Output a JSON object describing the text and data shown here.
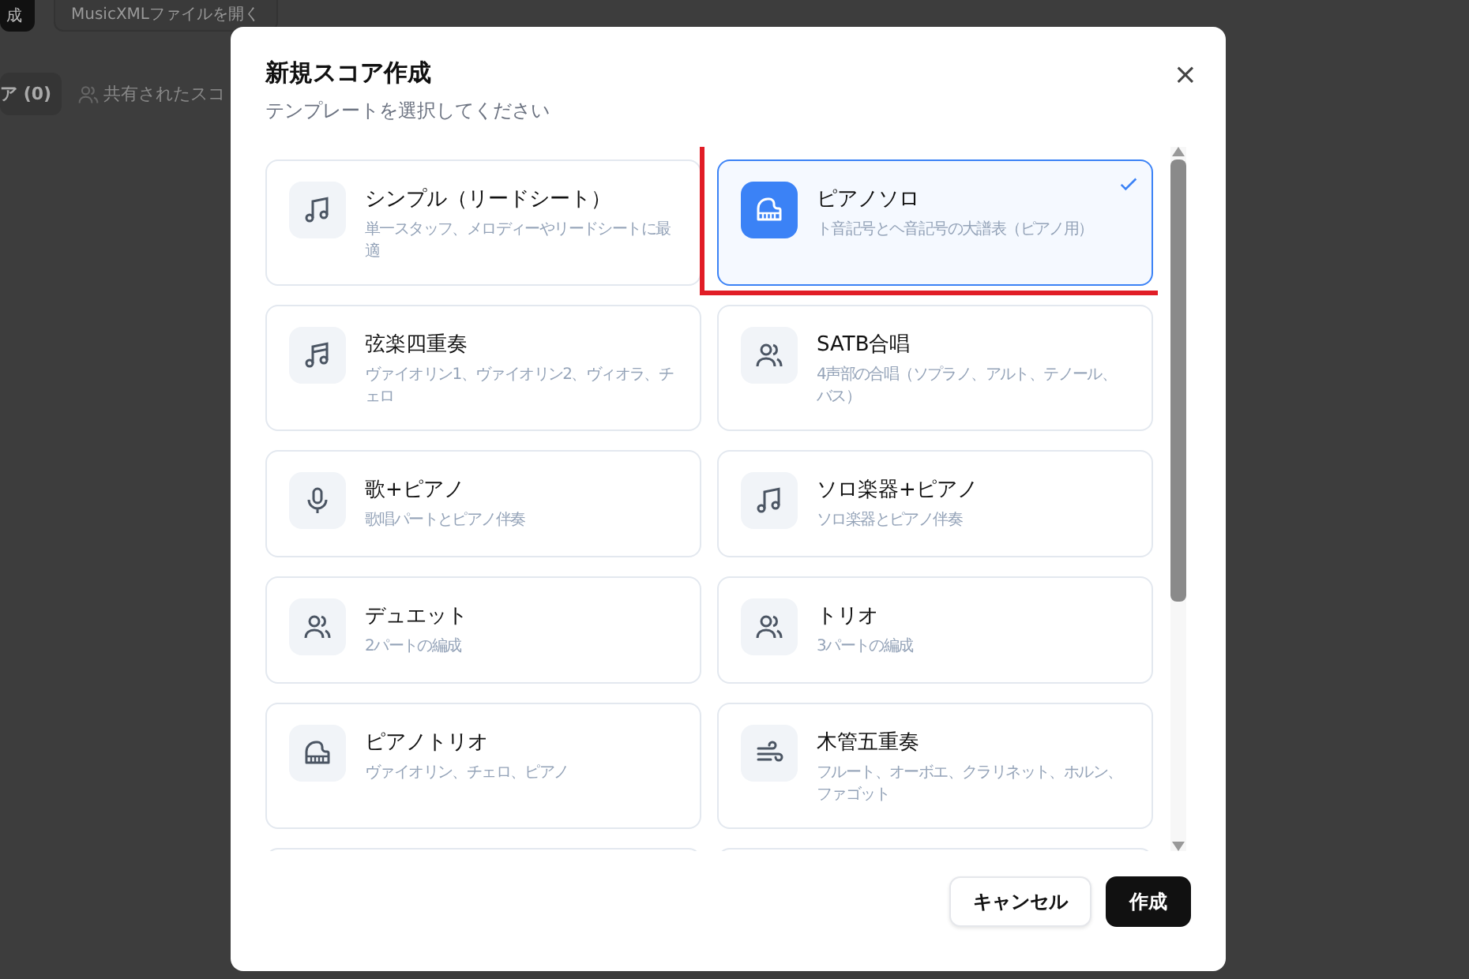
{
  "background": {
    "buttons": [
      {
        "label": "成",
        "kind": "primary"
      },
      {
        "label": "MusicXMLファイルを開く",
        "kind": "secondary"
      }
    ],
    "tabs": [
      {
        "label": "ア (0)",
        "selected": true,
        "kind": "plain"
      },
      {
        "label": "共有されたスコ",
        "selected": false,
        "kind": "shared"
      }
    ]
  },
  "dialog": {
    "title": "新規スコア作成",
    "subtitle": "テンプレートを選択してください",
    "close": "×",
    "templates": [
      {
        "title": "シンプル（リードシート）",
        "description": "単一スタッフ、メロディーやリードシートに最適",
        "kind": "note",
        "selected": false,
        "highlighted": false
      },
      {
        "title": "ピアノソロ",
        "description": "ト音記号とヘ音記号の大譜表（ピアノ用）",
        "kind": "piano",
        "selected": true,
        "highlighted": true
      },
      {
        "title": "弦楽四重奏",
        "description": "ヴァイオリン1、ヴァイオリン2、ヴィオラ、チェロ",
        "kind": "notes",
        "selected": false,
        "highlighted": false
      },
      {
        "title": "SATB合唱",
        "description": "4声部の合唱（ソプラノ、アルト、テノール、バス）",
        "kind": "people",
        "selected": false,
        "highlighted": false
      },
      {
        "title": "歌+ピアノ",
        "description": "歌唱パートとピアノ伴奏",
        "kind": "mic",
        "selected": false,
        "highlighted": false
      },
      {
        "title": "ソロ楽器+ピアノ",
        "description": "ソロ楽器とピアノ伴奏",
        "kind": "note",
        "selected": false,
        "highlighted": false
      },
      {
        "title": "デュエット",
        "description": "2パートの編成",
        "kind": "people",
        "selected": false,
        "highlighted": false
      },
      {
        "title": "トリオ",
        "description": "3パートの編成",
        "kind": "people",
        "selected": false,
        "highlighted": false
      },
      {
        "title": "ピアノトリオ",
        "description": "ヴァイオリン、チェロ、ピアノ",
        "kind": "piano",
        "selected": false,
        "highlighted": false
      },
      {
        "title": "木管五重奏",
        "description": "フルート、オーボエ、クラリネット、ホルン、ファゴット",
        "kind": "wind",
        "selected": false,
        "highlighted": false
      }
    ],
    "buttons": [
      {
        "label": "キャンセル",
        "kind": "secondary"
      },
      {
        "label": "作成",
        "kind": "primary"
      }
    ]
  }
}
